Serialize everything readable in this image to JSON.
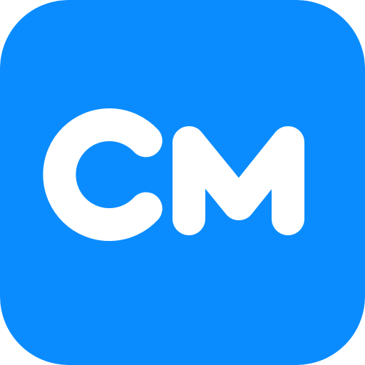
{
  "icon": {
    "monogram": "CM",
    "icon_name": "cm-monogram-icon",
    "colors": {
      "background": "#0A8CFF",
      "foreground": "#FFFFFF"
    }
  }
}
